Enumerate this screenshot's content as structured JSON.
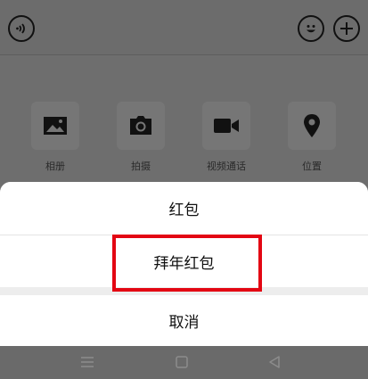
{
  "toolbar": {
    "icons": [
      "voice-icon",
      "emoji-icon",
      "plus-icon"
    ]
  },
  "tools": [
    {
      "label": "相册",
      "icon": "image-icon"
    },
    {
      "label": "拍摄",
      "icon": "camera-icon"
    },
    {
      "label": "视频通话",
      "icon": "video-icon"
    },
    {
      "label": "位置",
      "icon": "location-icon"
    }
  ],
  "sheet": {
    "items": [
      {
        "label": "红包"
      },
      {
        "label": "拜年红包"
      }
    ],
    "cancel": "取消"
  },
  "highlight_color": "#e30613",
  "navbar": {
    "icons": [
      "menu-icon",
      "home-icon",
      "back-icon"
    ]
  }
}
